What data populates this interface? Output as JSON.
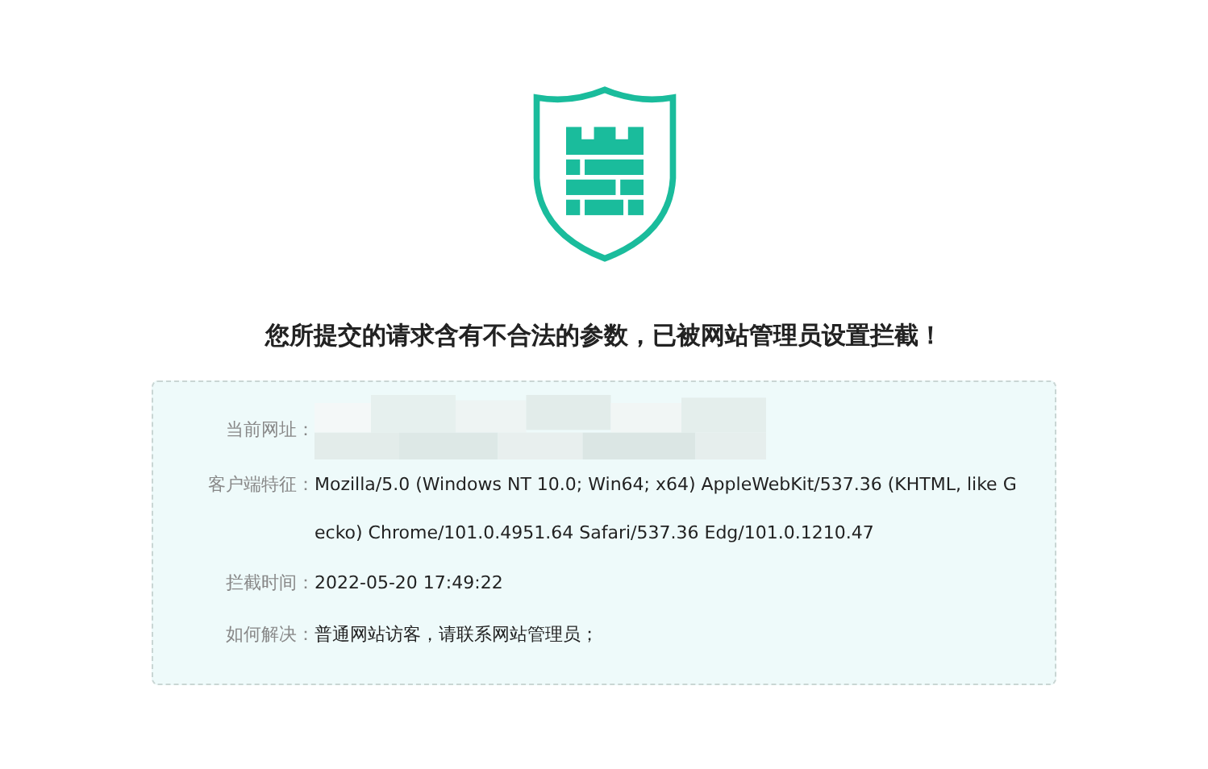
{
  "heading": "您所提交的请求含有不合法的参数，已被网站管理员设置拦截！",
  "details": [
    {
      "label": "当前网址：",
      "redacted": true
    },
    {
      "label": "客户端特征：",
      "value": "Mozilla/5.0 (Windows NT 10.0; Win64; x64) AppleWebKit/537.36 (KHTML, like Gecko) Chrome/101.0.4951.64 Safari/537.36 Edg/101.0.1210.47"
    },
    {
      "label": "拦截时间：",
      "value": "2022-05-20 17:49:22"
    },
    {
      "label": "如何解决：",
      "value": "普通网站访客，请联系网站管理员；"
    }
  ]
}
